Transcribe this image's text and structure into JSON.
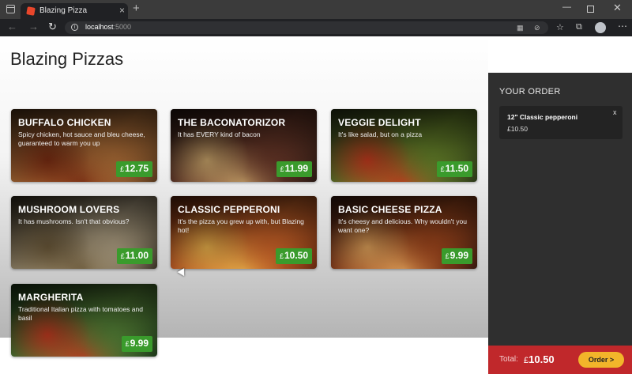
{
  "browser": {
    "tab_title": "Blazing Pizza",
    "tab_close": "×",
    "new_tab": "+",
    "url_host": "localhost",
    "url_port": ":5000",
    "back": "←",
    "forward": "→",
    "reload": "↻",
    "more": "⋯",
    "min": "—",
    "close": "✕"
  },
  "page": {
    "title": "Blazing Pizzas"
  },
  "pizzas": [
    {
      "name": "BUFFALO CHICKEN",
      "desc": "Spicy chicken, hot sauce and bleu cheese, guaranteed to warm you up",
      "currency": "£",
      "price": "12.75",
      "colors": [
        "#5a3a1e",
        "#b8743a",
        "#7a2c12"
      ]
    },
    {
      "name": "THE BACONATORIZOR",
      "desc": "It has EVERY kind of bacon",
      "currency": "£",
      "price": "11.99",
      "colors": [
        "#2a1a14",
        "#6e3a2a",
        "#c9a46a"
      ]
    },
    {
      "name": "VEGGIE DELIGHT",
      "desc": "It's like salad, but on a pizza",
      "currency": "£",
      "price": "11.50",
      "colors": [
        "#2e3a1a",
        "#6c8a2c",
        "#c43a1e"
      ]
    },
    {
      "name": "MUSHROOM LOVERS",
      "desc": "It has mushrooms. Isn't that obvious?",
      "currency": "£",
      "price": "11.00",
      "colors": [
        "#3b3426",
        "#b9a98a",
        "#6d5a3a"
      ]
    },
    {
      "name": "CLASSIC PEPPERONI",
      "desc": "It's the pizza you grew up with, but Blazing hot!",
      "currency": "£",
      "price": "10.50",
      "colors": [
        "#6a2a10",
        "#d8692a",
        "#e9b04a"
      ]
    },
    {
      "name": "BASIC CHEESE PIZZA",
      "desc": "It's cheesy and delicious. Why wouldn't you want one?",
      "currency": "£",
      "price": "9.99",
      "colors": [
        "#3a1a10",
        "#a84a1e",
        "#e0a25a"
      ]
    },
    {
      "name": "MARGHERITA",
      "desc": "Traditional Italian pizza with tomatoes and basil",
      "currency": "£",
      "price": "9.99",
      "colors": [
        "#1e3a1a",
        "#5a8a3a",
        "#c23a20"
      ]
    }
  ],
  "order": {
    "title": "YOUR ORDER",
    "item_name": "12\" Classic pepperoni",
    "item_currency": "£",
    "item_price": "10.50",
    "remove": "x",
    "total_label": "Total:",
    "total_currency": "£",
    "total_value": "10.50",
    "button_label": "Order >"
  }
}
